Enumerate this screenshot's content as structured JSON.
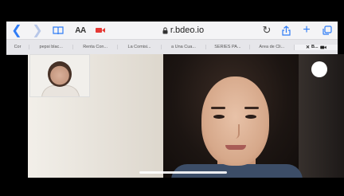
{
  "toolbar": {
    "reader_label": "AA",
    "url": "r.bdeo.io"
  },
  "tabs": [
    {
      "label": "Cor"
    },
    {
      "label": "pepsi blac..."
    },
    {
      "label": "Renta Con..."
    },
    {
      "label": "La Comisi..."
    },
    {
      "label": "a Una Cua..."
    },
    {
      "label": "SERIES PA..."
    },
    {
      "label": "Área de Cli..."
    },
    {
      "label": "B..."
    }
  ],
  "colors": {
    "accent": "#2f7cf6",
    "recording": "#e53935"
  },
  "icons": [
    "back-icon",
    "forward-icon",
    "bookmarks-icon",
    "recording-icon",
    "lock-icon",
    "reload-icon",
    "share-icon",
    "new-tab-icon",
    "tabs-icon"
  ]
}
